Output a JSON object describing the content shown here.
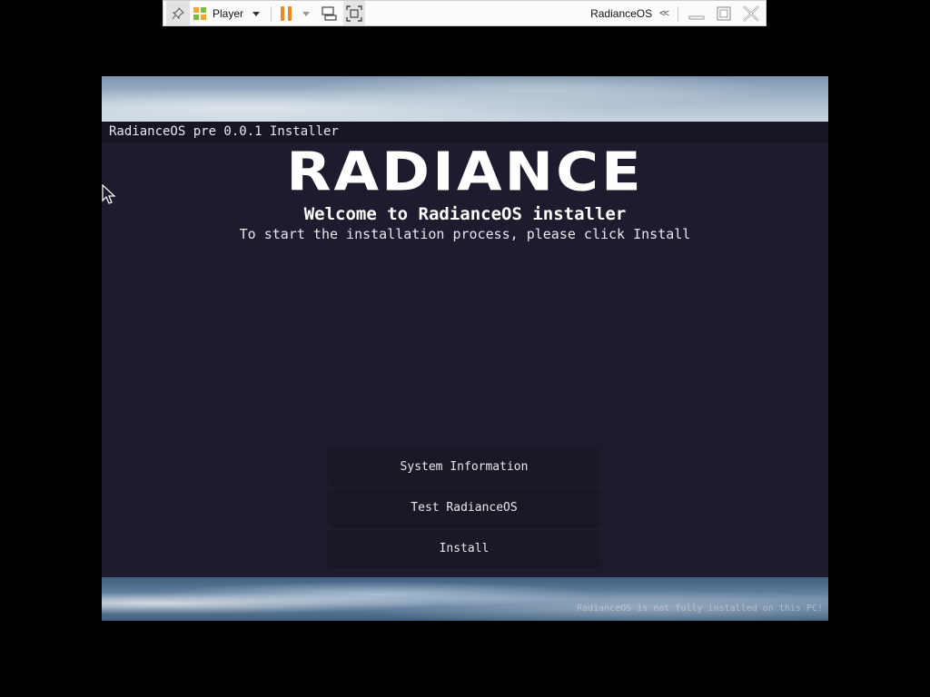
{
  "vm_toolbar": {
    "player_label": "Player",
    "vm_name": "RadianceOS",
    "chevrons": "<<",
    "icons": [
      "pin-icon",
      "player-logo-icon",
      "pause-icon",
      "send-ctrl-alt-del-icon",
      "fullscreen-icon",
      "minimize-icon",
      "restore-icon",
      "close-icon"
    ],
    "accent_color": "#f0861a"
  },
  "installer": {
    "window_title": "RadianceOS pre 0.0.1 Installer",
    "logo_text": "RADIANCE",
    "welcome": "Welcome to RadianceOS installer",
    "subtitle": "To start the installation process, please click Install",
    "buttons": {
      "system_information": "System Information",
      "test": "Test RadianceOS",
      "install": "Install"
    },
    "activation_note": "RadianceOS is not fully installed on this PC!",
    "background_color": "#1e1b2e"
  }
}
